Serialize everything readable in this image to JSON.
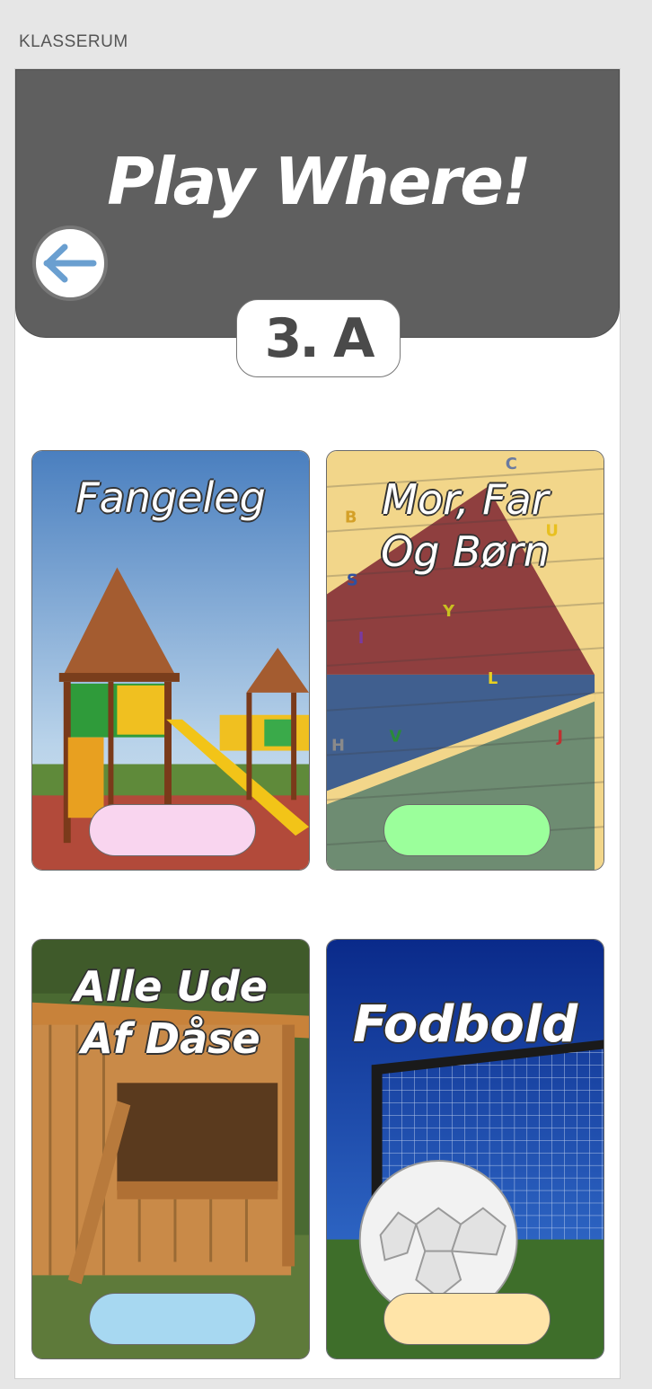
{
  "page": {
    "label": "KLASSERUM"
  },
  "header": {
    "title": "Play Where!",
    "back_icon": "arrow-left-icon",
    "class_name": "3. A"
  },
  "colors": {
    "header_bg": "#5f5f5f",
    "back_arrow": "#6a9fd0",
    "pill_pink": "#f9d5ef",
    "pill_green": "#9bff9b",
    "pill_blue": "#a7d8f1",
    "pill_yellow": "#ffe4a8"
  },
  "cards": [
    {
      "title": "Fangeleg",
      "button_color": "#f9d5ef"
    },
    {
      "title": "Mor, Far\nOg Børn",
      "button_color": "#9bff9b"
    },
    {
      "title": "Alle Ude\nAf Dåse",
      "button_color": "#a7d8f1"
    },
    {
      "title": "Fodbold",
      "button_color": "#ffe4a8"
    }
  ]
}
